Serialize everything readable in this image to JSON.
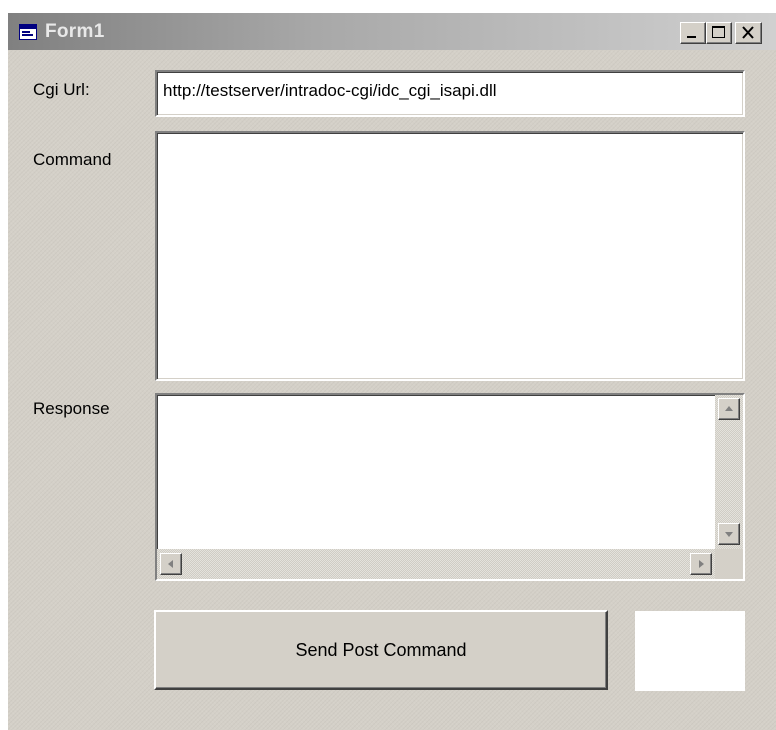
{
  "window": {
    "title": "Form1",
    "icon": "form-window-icon",
    "controls": {
      "minimize_icon": "minimize-icon",
      "maximize_icon": "maximize-icon",
      "close_icon": "close-icon"
    }
  },
  "form": {
    "cgi_url_label": "Cgi Url:",
    "cgi_url_value": "http://testserver/intradoc-cgi/idc_cgi_isapi.dll",
    "command_label": "Command",
    "command_value": "",
    "response_label": "Response",
    "response_value": "",
    "send_button_label": "Send Post Command"
  },
  "colors": {
    "face": "#d4d0c8",
    "titlebar_start": "#808080",
    "titlebar_end": "#d0d0d0",
    "field_background": "#ffffff"
  }
}
